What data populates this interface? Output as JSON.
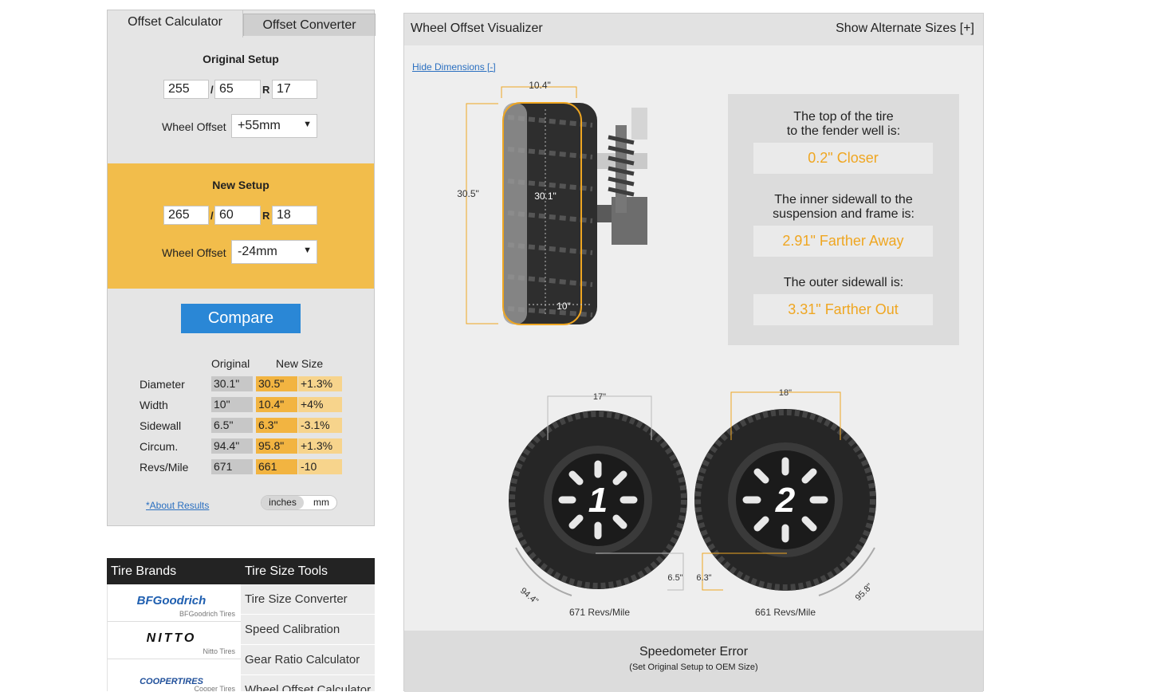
{
  "tabs": {
    "active": "Offset Calculator",
    "inactive": "Offset Converter"
  },
  "original": {
    "title": "Original Setup",
    "width": "255",
    "aspect": "65",
    "rim": "17",
    "sep1": "/",
    "sep2": "R",
    "offset_label": "Wheel Offset",
    "offset_value": "+55mm"
  },
  "new": {
    "title": "New Setup",
    "width": "265",
    "aspect": "60",
    "rim": "18",
    "sep1": "/",
    "sep2": "R",
    "offset_label": "Wheel Offset",
    "offset_value": "-24mm"
  },
  "compare_label": "Compare",
  "results": {
    "headers": [
      "Original",
      "New Size"
    ],
    "rows": [
      {
        "label": "Diameter",
        "orig": "30.1\"",
        "new": "30.5\"",
        "diff": "+1.3%"
      },
      {
        "label": "Width",
        "orig": "10\"",
        "new": "10.4\"",
        "diff": "+4%"
      },
      {
        "label": "Sidewall",
        "orig": "6.5\"",
        "new": "6.3\"",
        "diff": "-3.1%"
      },
      {
        "label": "Circum.",
        "orig": "94.4\"",
        "new": "95.8\"",
        "diff": "+1.3%"
      },
      {
        "label": "Revs/Mile",
        "orig": "671",
        "new": "661",
        "diff": "-10"
      }
    ],
    "about": "*About Results",
    "units": [
      "inches",
      "mm"
    ]
  },
  "brands": {
    "title": "Tire Brands",
    "items": [
      {
        "logo": "BFGoodrich",
        "caption": "BFGoodrich Tires",
        "color": "#1f5fb0"
      },
      {
        "logo": "NITTO",
        "caption": "Nitto Tires",
        "color": "#111111"
      },
      {
        "logo": "COOPERTIRES",
        "caption": "Cooper Tires",
        "color": "#1f4f9a"
      }
    ]
  },
  "tools": {
    "title": "Tire Size Tools",
    "items": [
      "Tire Size Converter",
      "Speed Calibration",
      "Gear Ratio Calculator",
      "Wheel Offset Calculator"
    ]
  },
  "visualizer": {
    "title": "Wheel Offset Visualizer",
    "alt_sizes": "Show Alternate Sizes [+]",
    "hide_dims": "Hide Dimensions [-]",
    "dims": {
      "new_width": "10.4\"",
      "new_dia": "30.5\"",
      "orig_dia": "30.1\"",
      "orig_width": "10\""
    },
    "info": [
      {
        "q1": "The top of the tire",
        "q2": "to the fender well is:",
        "a": "0.2\" Closer"
      },
      {
        "q1": "The inner sidewall to the",
        "q2": "suspension and frame is:",
        "a": "2.91\" Farther Away"
      },
      {
        "q1": "The outer sidewall is:",
        "q2": "",
        "a": "3.31\" Farther Out"
      }
    ],
    "wheels": [
      {
        "number": "1",
        "rim": "17\"",
        "sidewall": "6.5\"",
        "circ": "94.4\"",
        "revs": "671 Revs/Mile"
      },
      {
        "number": "2",
        "rim": "18\"",
        "sidewall": "6.3\"",
        "circ": "95.8\"",
        "revs": "661 Revs/Mile"
      }
    ],
    "accent": "#efa621"
  },
  "speedometer": {
    "title": "Speedometer Error",
    "subtitle": "(Set Original Setup to OEM Size)"
  }
}
